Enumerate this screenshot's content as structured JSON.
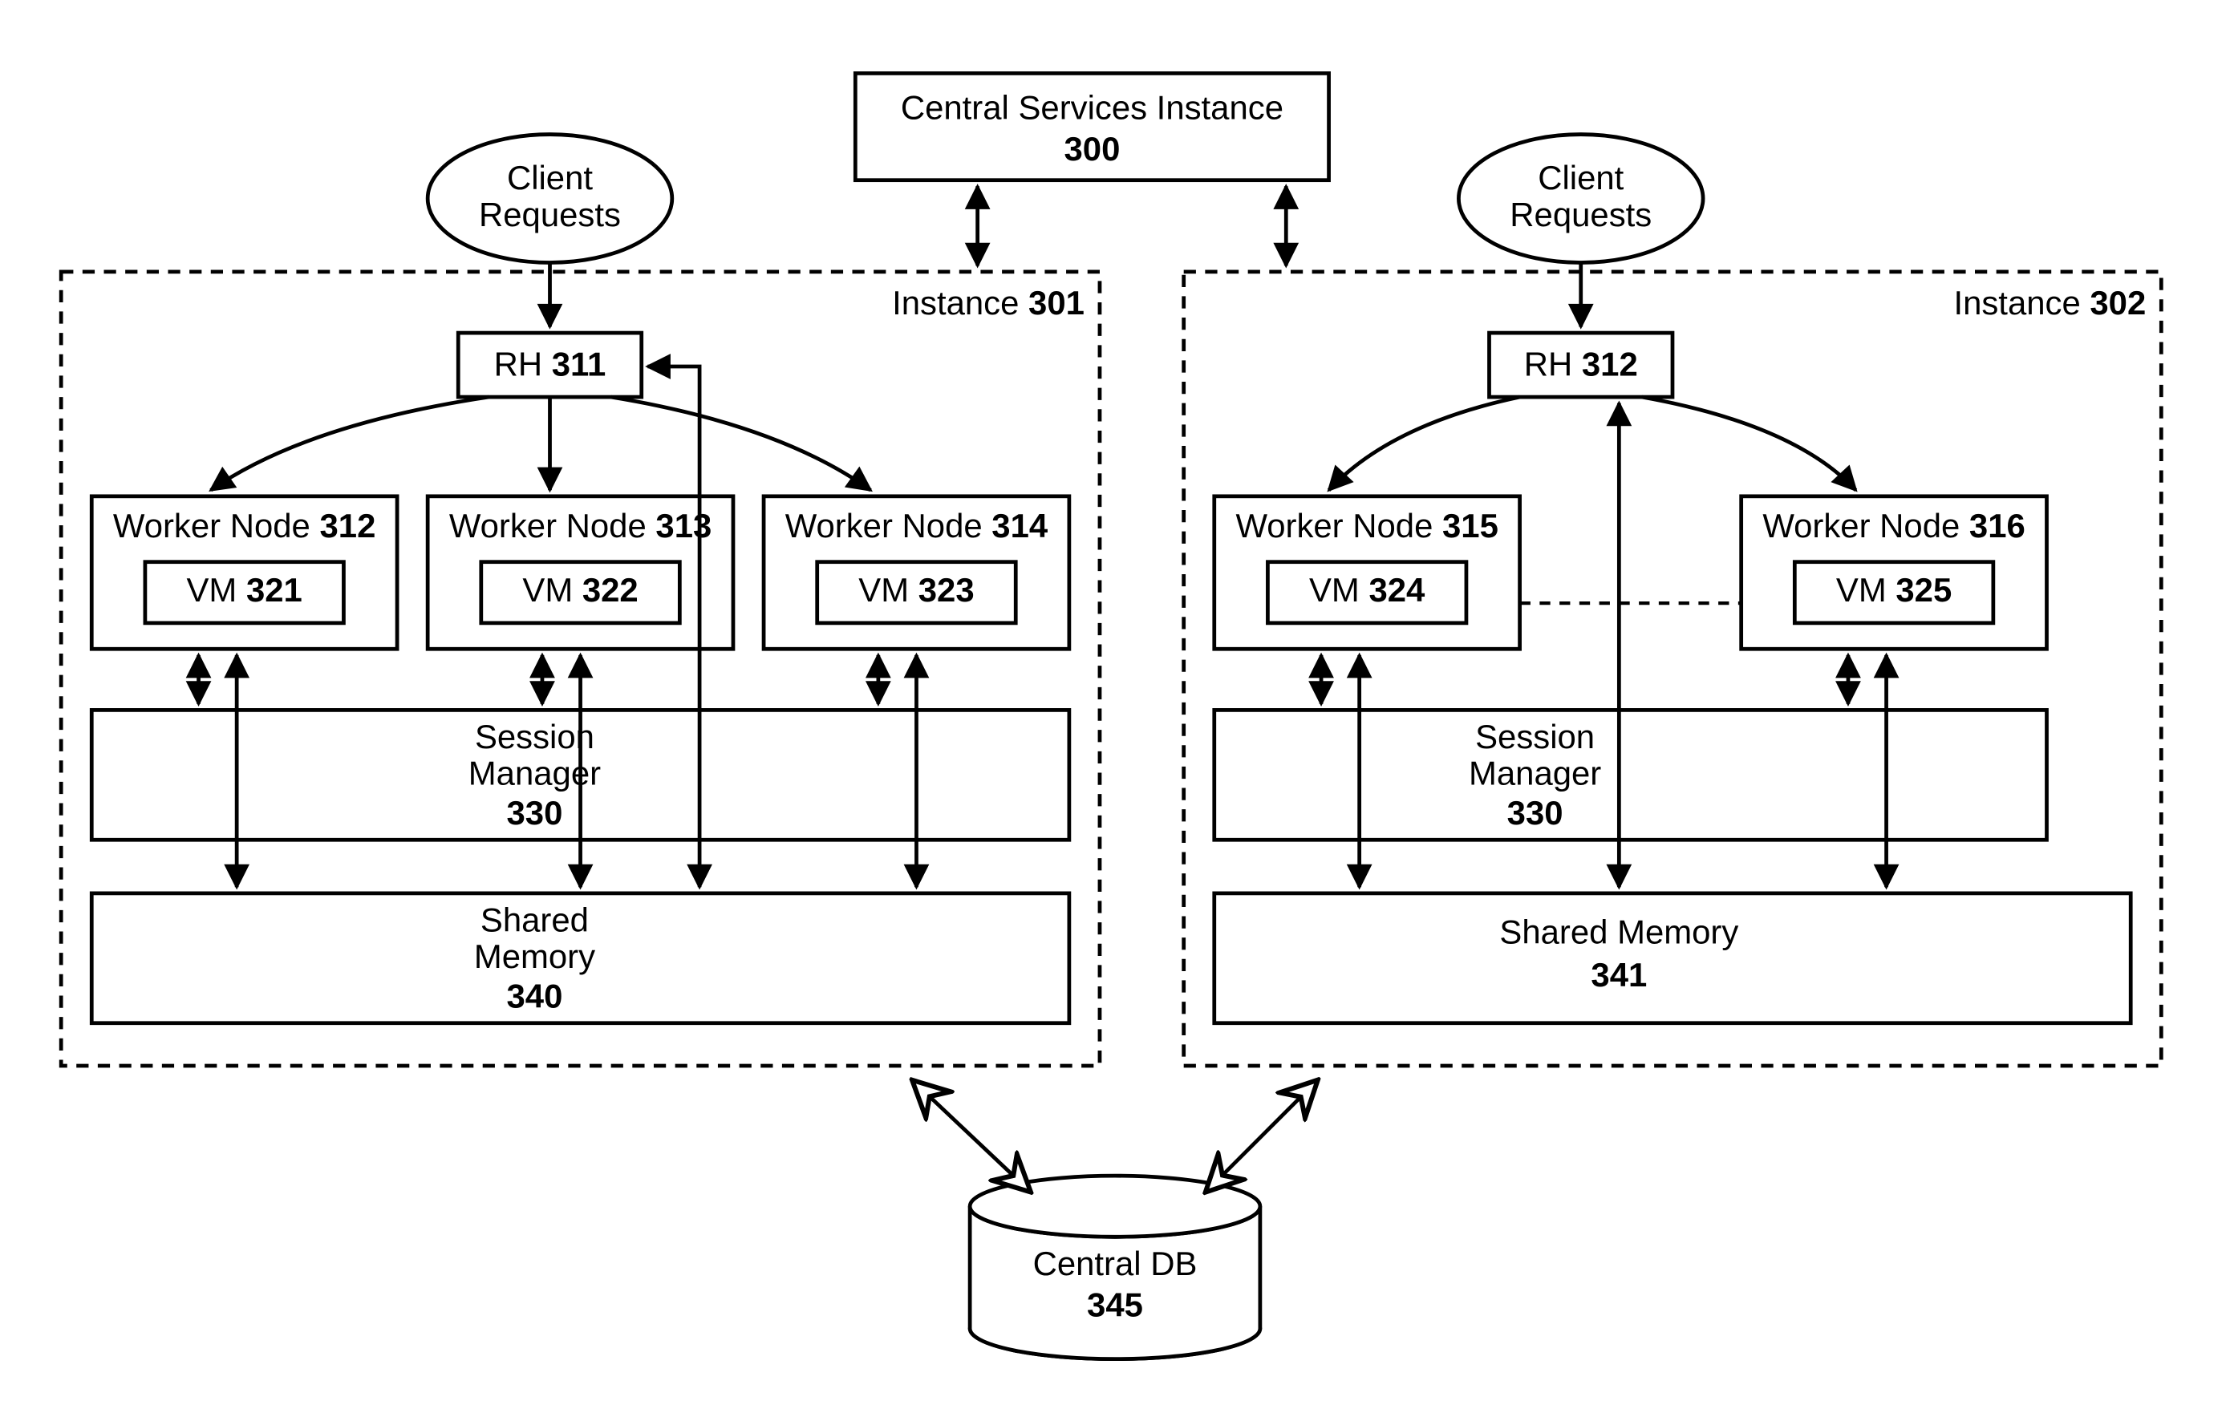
{
  "central_services": {
    "title": "Central Services Instance",
    "num": "300"
  },
  "clients": {
    "left": "Client",
    "right": "Client",
    "sub": "Requests"
  },
  "instance_left": {
    "label_prefix": "Instance ",
    "label_num": "301",
    "rh": {
      "prefix": "RH ",
      "num": "311"
    },
    "workers": [
      {
        "title_prefix": "Worker Node ",
        "title_num": "312",
        "vm_prefix": "VM ",
        "vm_num": "321"
      },
      {
        "title_prefix": "Worker Node ",
        "title_num": "313",
        "vm_prefix": "VM ",
        "vm_num": "322"
      },
      {
        "title_prefix": "Worker Node ",
        "title_num": "314",
        "vm_prefix": "VM ",
        "vm_num": "323"
      }
    ],
    "session": {
      "l1": "Session",
      "l2": "Manager",
      "num": "330"
    },
    "shared": {
      "l1": "Shared",
      "l2": "Memory",
      "num": "340"
    }
  },
  "instance_right": {
    "label_prefix": "Instance ",
    "label_num": "302",
    "rh": {
      "prefix": "RH ",
      "num": "312"
    },
    "workers": [
      {
        "title_prefix": "Worker Node ",
        "title_num": "315",
        "vm_prefix": "VM ",
        "vm_num": "324"
      },
      {
        "title_prefix": "Worker Node ",
        "title_num": "316",
        "vm_prefix": "VM ",
        "vm_num": "325"
      }
    ],
    "session": {
      "l1": "Session",
      "l2": "Manager",
      "num": "330"
    },
    "shared": {
      "l1": "Shared Memory",
      "num": "341"
    }
  },
  "db": {
    "title": "Central DB",
    "num": "345"
  }
}
